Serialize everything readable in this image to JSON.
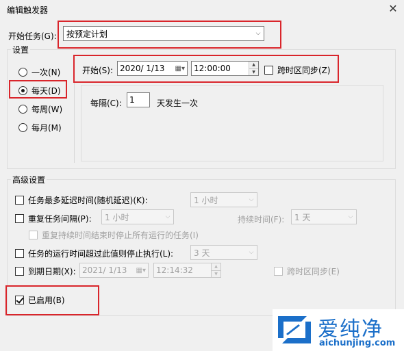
{
  "window": {
    "title": "编辑触发器"
  },
  "begin_task": {
    "label": "开始任务(G):",
    "value": "按预定计划"
  },
  "settings": {
    "legend": "设置",
    "frequency": [
      {
        "label": "一次(N)"
      },
      {
        "label": "每天(D)"
      },
      {
        "label": "每周(W)"
      },
      {
        "label": "每月(M)"
      }
    ],
    "selected_frequency": "每天(D)",
    "start_label": "开始(S):",
    "start_date": "2020/  1/13",
    "start_time": "12:00:00",
    "sync_label": "跨时区同步(Z)",
    "every_label": "每隔(C):",
    "every_value": "1",
    "every_unit": "天发生一次"
  },
  "advanced": {
    "legend": "高级设置",
    "delay_label": "任务最多延迟时间(随机延迟)(K):",
    "delay_value": "1 小时",
    "repeat_label": "重复任务间隔(P):",
    "repeat_value": "1 小时",
    "duration_label": "持续时间(F):",
    "duration_value": "1 天",
    "stop_all_label": "重复持续时间结束时停止所有运行的任务(I)",
    "stop_if_label": "任务的运行时间超过此值则停止执行(L):",
    "stop_if_value": "3 天",
    "expire_label": "到期日期(X):",
    "expire_date": "2021/  1/13",
    "expire_time": "12:14:32",
    "expire_sync_label": "跨时区同步(E)",
    "enabled_label": "已启用(B)"
  },
  "watermark": {
    "text": "爱纯净",
    "url_text": "aichunjing.com"
  },
  "colors": {
    "highlight": "#d9252b",
    "brand": "#1b6fc9"
  }
}
